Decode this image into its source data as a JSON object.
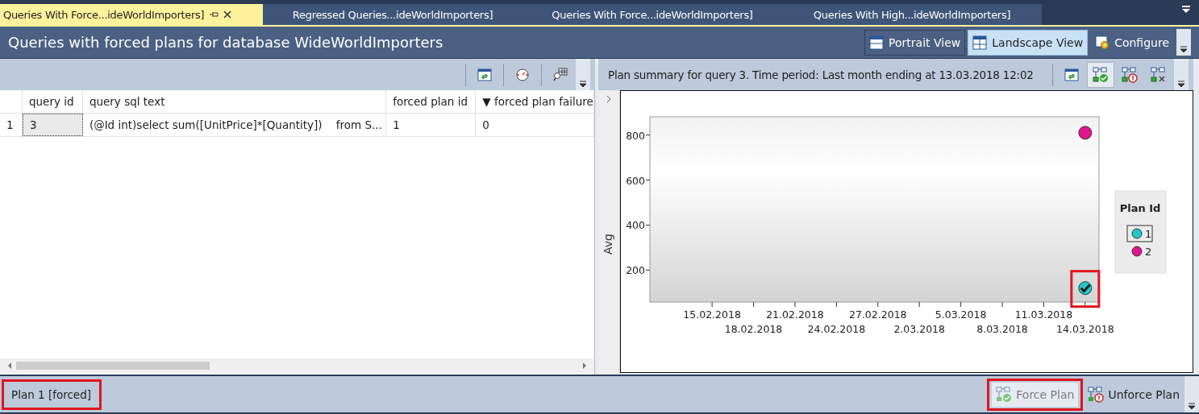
{
  "tabs": [
    {
      "label": "Queries With Force...ideWorldImporters]",
      "selected": true
    },
    {
      "label": "Regressed Queries...ideWorldImporters]",
      "selected": false
    },
    {
      "label": "Queries With Force...ideWorldImporters]",
      "selected": false
    },
    {
      "label": "Queries With High...ideWorldImporters]",
      "selected": false
    }
  ],
  "title": "Queries with forced plans for database WideWorldImporters",
  "view_buttons": [
    {
      "label": "Portrait View",
      "kind": "portrait",
      "selected": false
    },
    {
      "label": "Landscape View",
      "kind": "landscape",
      "selected": true
    },
    {
      "label": "Configure",
      "kind": "configure",
      "selected": false
    }
  ],
  "grid": {
    "columns": [
      "",
      "query id",
      "query sql text",
      "forced plan id",
      "▼ forced plan failure"
    ],
    "rows": [
      [
        "1",
        "3",
        "(@Id int)select sum([UnitPrice]*[Quantity])    from S...",
        "1",
        "0"
      ]
    ]
  },
  "summary": {
    "title": "Plan summary for query 3. Time period: Last month ending at 13.03.2018 12:02",
    "tools": [
      {
        "kind": "refresh",
        "selected": false
      },
      {
        "kind": "force",
        "selected": true
      },
      {
        "kind": "unforce",
        "selected": false
      },
      {
        "kind": "compare",
        "selected": false
      }
    ],
    "chart_data": {
      "type": "scatter",
      "ylabel": "Avg",
      "ylim": [
        58,
        881
      ],
      "categories": [
        null,
        null,
        null,
        null,
        "15.02.2018",
        null,
        null,
        "18.02.2018",
        null,
        null,
        "21.02.2018",
        null,
        null,
        "24.02.2018",
        null,
        null,
        "27.02.2018",
        null,
        null,
        "2.03.2018",
        null,
        null,
        "5.03.2018",
        null,
        null,
        "8.03.2018",
        null,
        null,
        "11.03.2018",
        null,
        null,
        "14.03.2018"
      ],
      "yticks": [
        200,
        400,
        600,
        800
      ],
      "series": [
        {
          "name": "1",
          "color": "#20c8c8",
          "values": [
            null,
            null,
            null,
            null,
            null,
            null,
            null,
            null,
            null,
            null,
            null,
            null,
            null,
            null,
            null,
            null,
            null,
            null,
            null,
            null,
            null,
            null,
            null,
            null,
            null,
            null,
            null,
            null,
            null,
            null,
            null,
            120
          ]
        },
        {
          "name": "2",
          "color": "#e0148c",
          "values": [
            null,
            null,
            null,
            null,
            null,
            null,
            null,
            null,
            null,
            null,
            null,
            null,
            null,
            null,
            null,
            null,
            null,
            null,
            null,
            null,
            null,
            null,
            null,
            null,
            null,
            null,
            null,
            null,
            null,
            null,
            null,
            810
          ]
        }
      ],
      "annotations": [
        {
          "x": "14.03.2018"
        }
      ],
      "legend": {
        "title": "Plan Id"
      }
    },
    "legend_items": [
      {
        "selected": true
      },
      {
        "selected": false
      }
    ]
  },
  "status": "Plan 1 [forced]",
  "actions": [
    {
      "label": "Force Plan",
      "kind": "force",
      "disabled": true
    },
    {
      "label": "Unforce Plan",
      "kind": "unforce",
      "disabled": false
    }
  ]
}
